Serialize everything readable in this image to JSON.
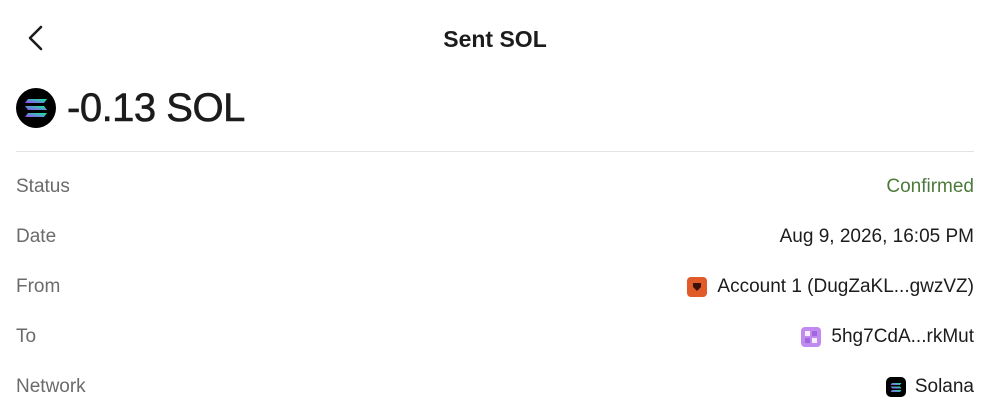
{
  "header": {
    "title": "Sent SOL",
    "back_icon": "chevron-left-icon"
  },
  "amount": {
    "text": "-0.13 SOL",
    "token_icon": "solana-logo-icon"
  },
  "details": [
    {
      "key": "status",
      "label": "Status",
      "value": "Confirmed",
      "value_color": "#4c7a3c"
    },
    {
      "key": "date",
      "label": "Date",
      "value": "Aug 9, 2026, 16:05 PM"
    },
    {
      "key": "from",
      "label": "From",
      "value": "Account 1 (DugZaKL...gwzVZ)",
      "icon": "account-avatar-icon",
      "icon_color": "#e05a2a"
    },
    {
      "key": "to",
      "label": "To",
      "value": "5hg7CdA...rkMut",
      "icon": "address-avatar-icon",
      "icon_color": "#c08af0"
    },
    {
      "key": "network",
      "label": "Network",
      "value": "Solana",
      "icon": "solana-network-icon"
    }
  ]
}
